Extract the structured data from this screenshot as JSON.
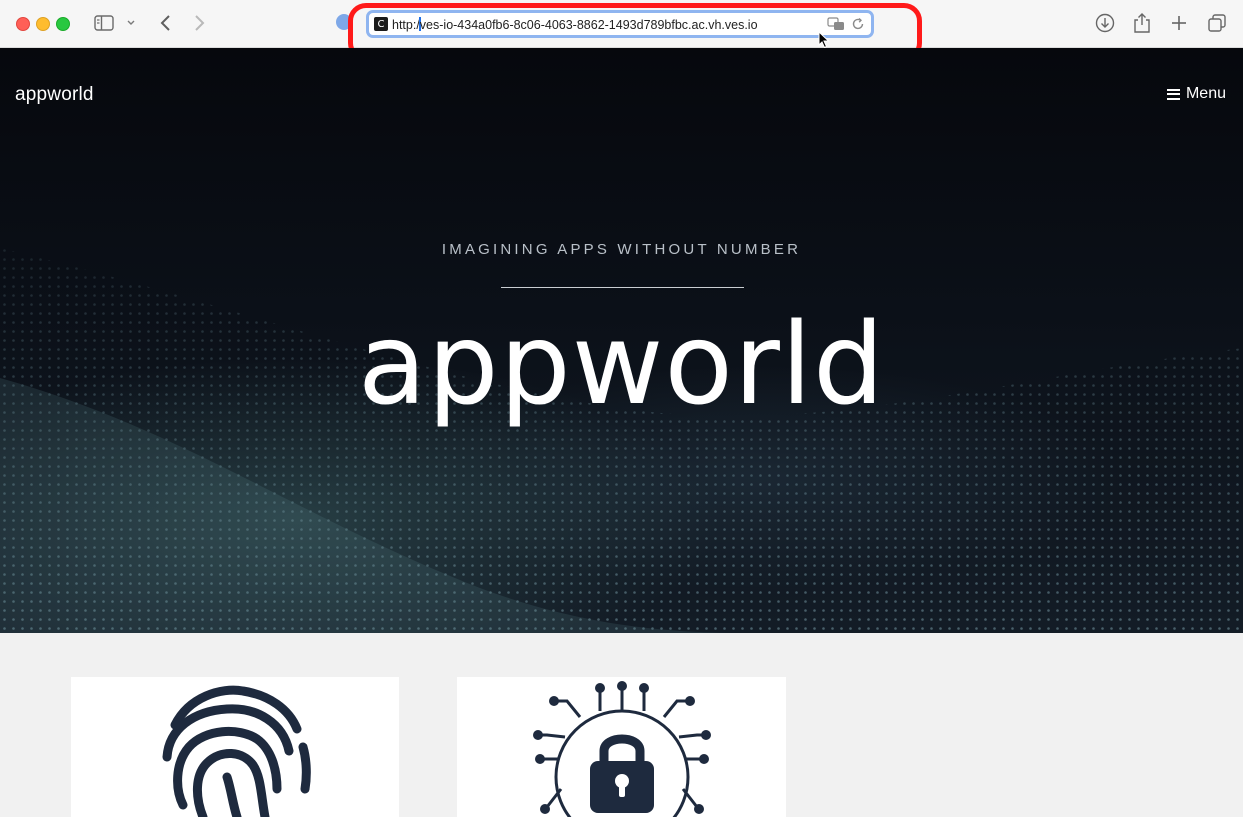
{
  "browser": {
    "url_prefix": "http:/",
    "url_rest": "ves-io-434a0fb6-8c06-4063-8862-1493d789bfbc.ac.vh.ves.io",
    "favicon_glyph": "C"
  },
  "site": {
    "logo": "appworld",
    "menu_label": "Menu"
  },
  "hero": {
    "tagline": "IMAGINING APPS WITHOUT NUMBER",
    "title": "appworld"
  },
  "cards": [
    {
      "icon": "fingerprint-icon"
    },
    {
      "icon": "circuit-lock-icon"
    }
  ],
  "colors": {
    "highlight_border": "#ff1a1a",
    "url_focus": "#8fb5f0",
    "hero_bg": "#0b1018",
    "page_bg": "#f1f1f1",
    "icon_navy": "#1e2a3e"
  }
}
